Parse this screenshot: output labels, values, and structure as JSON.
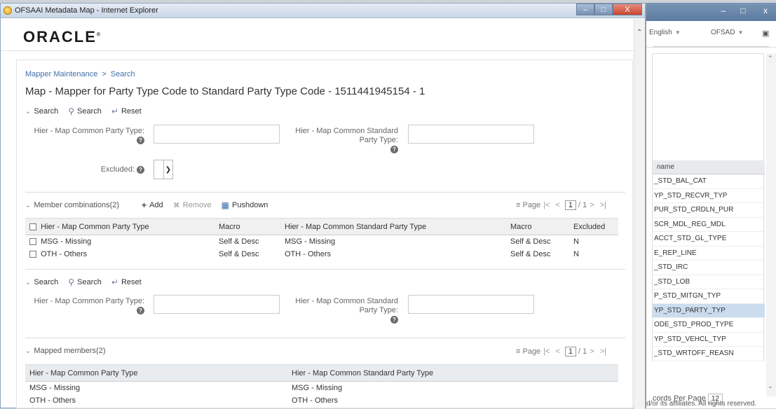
{
  "window": {
    "title": "OFSAAI Metadata Map - Internet Explorer",
    "min_glyph": "–",
    "max_glyph": "□",
    "close_glyph": "X"
  },
  "brand": {
    "logo_text": "ORACLE"
  },
  "breadcrumb": {
    "root": "Mapper Maintenance",
    "separator": ">",
    "current": "Search"
  },
  "page_title": "Map - Mapper for Party Type Code to Standard Party Type Code - 1511441945154 - 1",
  "search_bar_1": {
    "section_label": "Search",
    "search_label": "Search",
    "reset_label": "Reset"
  },
  "filters_1": {
    "party_type_label": "Hier - Map Common Party Type:",
    "party_type_value": "",
    "std_party_type_label_1": "Hier - Map Common Standard",
    "std_party_type_label_2": "Party Type:",
    "std_party_type_value": "",
    "excluded_label": "Excluded:"
  },
  "member_combinations": {
    "title": "Member combinations(2)",
    "add_label": "Add",
    "remove_label": "Remove",
    "pushdown_label": "Pushdown",
    "pager": {
      "label": "Page",
      "current": "1",
      "total": "/ 1"
    },
    "columns": [
      "Hier - Map Common Party Type",
      "Macro",
      "Hier - Map Common Standard Party Type",
      "Macro",
      "Excluded"
    ],
    "rows": [
      [
        "MSG - Missing",
        "Self & Desc",
        "MSG - Missing",
        "Self & Desc",
        "N"
      ],
      [
        "OTH - Others",
        "Self & Desc",
        "OTH - Others",
        "Self & Desc",
        "N"
      ]
    ]
  },
  "search_bar_2": {
    "section_label": "Search",
    "search_label": "Search",
    "reset_label": "Reset"
  },
  "filters_2": {
    "party_type_label": "Hier - Map Common Party Type:",
    "party_type_value": "",
    "std_party_type_label_1": "Hier - Map Common Standard",
    "std_party_type_label_2": "Party Type:",
    "std_party_type_value": ""
  },
  "mapped_members": {
    "title": "Mapped members(2)",
    "pager": {
      "label": "Page",
      "current": "1",
      "total": "/ 1"
    },
    "columns": [
      "Hier - Map Common Party Type",
      "Hier - Map Common Standard Party Type"
    ],
    "rows": [
      [
        "MSG - Missing",
        "MSG - Missing"
      ],
      [
        "OTH - Others",
        "OTH - Others"
      ]
    ]
  },
  "background_app": {
    "language": "English",
    "app": "OFSAD",
    "column_header": "name",
    "items": [
      "_STD_BAL_CAT",
      "YP_STD_RECVR_TYP",
      "PUR_STD_CRDLN_PUR",
      "SCR_MDL_REG_MDL",
      "ACCT_STD_GL_TYPE",
      "E_REP_LINE",
      "_STD_IRC",
      "_STD_LOB",
      "P_STD_MITGN_TYP",
      "YP_STD_PARTY_TYP",
      "ODE_STD_PROD_TYPE",
      "YP_STD_VEHCL_TYP",
      "_STD_WRTOFF_REASN"
    ],
    "selected_index": 9,
    "records_per_page_label": "cords Per Page",
    "records_per_page_value": "12",
    "footer": "d/or its affiliates. All rights reserved."
  },
  "colors": {
    "link": "#3f6fa6",
    "selected_row": "#cbdcee",
    "close_button": "#c54530"
  }
}
